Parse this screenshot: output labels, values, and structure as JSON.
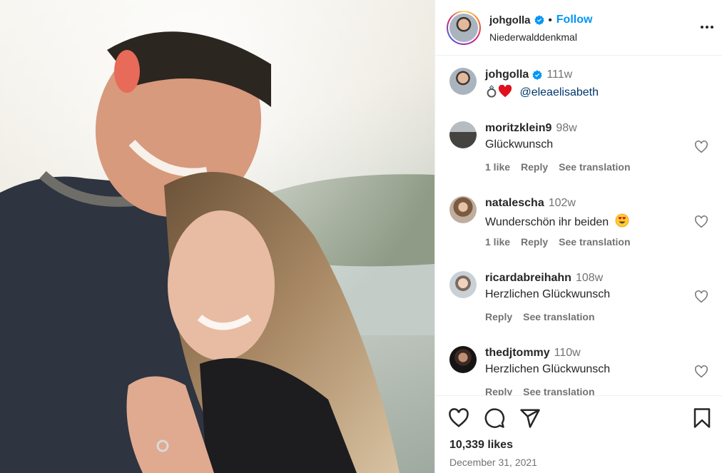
{
  "post": {
    "username": "johgolla",
    "follow_label": "Follow",
    "location": "Niederwalddenkmal",
    "caption_time": "111w",
    "caption_mention": "@eleaelisabeth",
    "likes": "10,339 likes",
    "date": "December 31, 2021"
  },
  "comments": [
    {
      "username": "moritzklein9",
      "time": "98w",
      "text": "Glückwunsch",
      "likes": "1 like",
      "reply": "Reply",
      "translate": "See translation"
    },
    {
      "username": "natalescha",
      "time": "102w",
      "text": "Wunderschön ihr beiden",
      "likes": "1 like",
      "reply": "Reply",
      "translate": "See translation"
    },
    {
      "username": "ricardabreihahn",
      "time": "108w",
      "text": "Herzlichen Glückwunsch",
      "reply": "Reply",
      "translate": "See translation"
    },
    {
      "username": "thedjtommy",
      "time": "110w",
      "text": "Herzlichen Glückwunsch",
      "reply": "Reply",
      "translate": "See translation"
    }
  ],
  "icons": {
    "verified": "verified-badge-icon",
    "more": "more-options-icon",
    "like": "heart-icon",
    "comment": "comment-icon",
    "share": "share-icon",
    "save": "bookmark-icon"
  },
  "colors": {
    "accent": "#0095f6",
    "mention": "#00376b",
    "muted": "#737373"
  }
}
